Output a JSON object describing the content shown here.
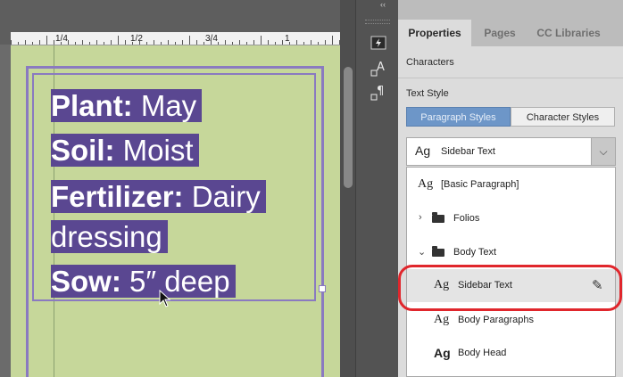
{
  "document": {
    "ruler_labels": [
      "1/4",
      "1/2",
      "3/4",
      "1"
    ],
    "text_lines": [
      {
        "bold": "Plant:",
        "rest": " May"
      },
      {
        "bold": "Soil:",
        "rest": " Moist"
      },
      {
        "bold": "Fertilizer:",
        "rest": " Dairy"
      },
      {
        "bold": "",
        "rest": "dressing"
      },
      {
        "bold": "Sow:",
        "rest": " 5″ deep"
      }
    ],
    "highlight_color": "#5a4791",
    "page_color": "#c6d79a"
  },
  "toolstrip": {
    "collapse_glyph": "‹‹",
    "tools": [
      "lightning-panel-icon",
      "character-styles-icon",
      "paragraph-styles-icon"
    ]
  },
  "panel": {
    "tabs": [
      {
        "label": "Properties",
        "active": true
      },
      {
        "label": "Pages",
        "active": false
      },
      {
        "label": "CC Libraries",
        "active": false
      }
    ],
    "characters_label": "Characters",
    "text_style_label": "Text Style",
    "segmented": {
      "paragraph": "Paragraph Styles",
      "character": "Character Styles"
    },
    "dropdown": {
      "ag": "Ag",
      "value": "Sidebar Text"
    },
    "style_list": [
      {
        "ag": "Ag",
        "label": "[Basic Paragraph]",
        "type": "style"
      },
      {
        "label": "Folios",
        "type": "folder",
        "expanded": false
      },
      {
        "label": "Body Text",
        "type": "folder",
        "expanded": true
      },
      {
        "ag": "Ag",
        "label": "Sidebar Text",
        "type": "style",
        "selected": true
      },
      {
        "ag": "Ag",
        "label": "Body Paragraphs",
        "type": "style"
      },
      {
        "ag": "Ag",
        "label": "Body Head",
        "type": "style",
        "bold": true
      }
    ],
    "accent_color": "#6d96c8",
    "callout_color": "#e0262c"
  }
}
